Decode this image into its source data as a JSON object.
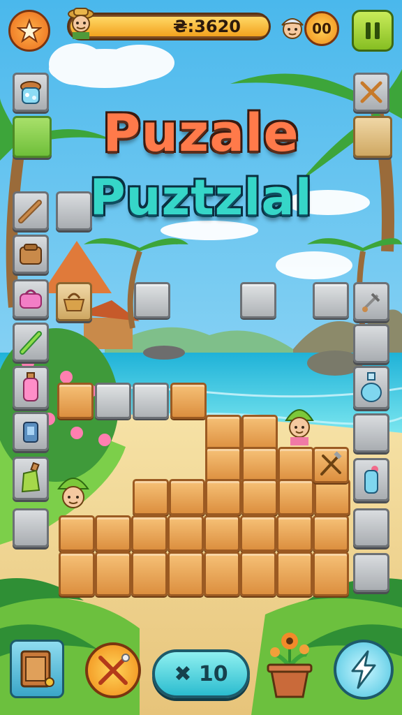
{
  "title": {
    "line1": "Puzale",
    "line2": "Puztzlal"
  },
  "hud": {
    "score_text": "₴:3620",
    "coins_text": "00",
    "pause_icon": "pause-icon",
    "menu_icon": "star-badge-icon",
    "progress_fraction": 1.0
  },
  "bottom_bar": {
    "multiplier_text": "✖ 10",
    "left_button_icon": "chest-icon",
    "cancel_button_icon": "tools-crossed-icon",
    "plant_icon": "flower-pot-icon",
    "power_button_icon": "lightning-icon"
  },
  "left_column_items": [
    "crystal-jar-icon",
    "green-tile",
    "log-icon",
    "grey-tile",
    "bag-icon",
    "basket-icon",
    "pink-purse-icon",
    "bamboo-icon",
    "potion-bottle-icon",
    "lantern-icon",
    "green-bottle-icon",
    "empty-slot"
  ],
  "right_column_items": [
    "crossed-swords-icon",
    "tan-tile",
    "scroll-wheel-icon",
    "empty-slot",
    "water-bottle-icon",
    "empty-slot",
    "crossed-tools-icon",
    "potion-flask-icon",
    "empty-slot",
    "empty-slot"
  ],
  "characters": [
    "explorer-avatar",
    "turban-avatar",
    "green-hat-girl",
    "green-hat-girl-2"
  ],
  "colors": {
    "title_top": "#ff7a4a",
    "title_bottom": "#36d6c8",
    "block": "#e8a45a",
    "slot_grey": "#bfc2c5",
    "sea": "#2fc9e0",
    "sky": "#7fd2f5"
  }
}
